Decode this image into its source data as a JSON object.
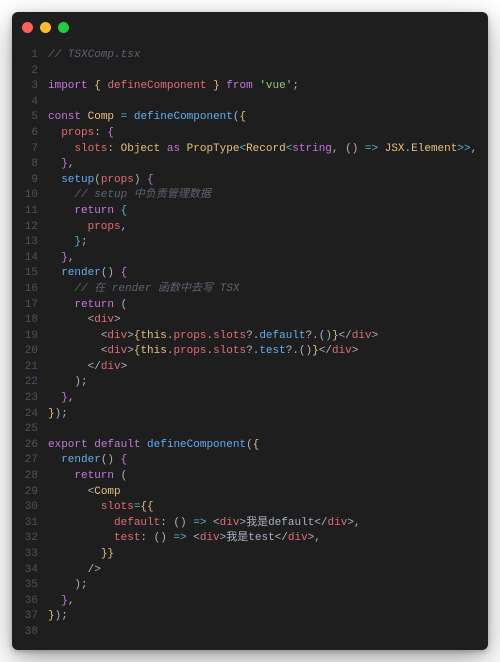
{
  "window": {
    "buttons": [
      "close",
      "minimize",
      "zoom"
    ]
  },
  "code": {
    "lines": [
      {
        "n": "1",
        "tokens": [
          [
            "cm",
            "// TSXComp.tsx"
          ]
        ]
      },
      {
        "n": "2",
        "tokens": [
          [
            "pn",
            ""
          ]
        ]
      },
      {
        "n": "3",
        "tokens": [
          [
            "kw",
            "import"
          ],
          [
            "pn",
            " "
          ],
          [
            "br",
            "{"
          ],
          [
            "pn",
            " "
          ],
          [
            "id",
            "defineComponent"
          ],
          [
            "pn",
            " "
          ],
          [
            "br",
            "}"
          ],
          [
            "pn",
            " "
          ],
          [
            "kw",
            "from"
          ],
          [
            "pn",
            " "
          ],
          [
            "str",
            "'vue'"
          ],
          [
            "pn",
            ";"
          ]
        ]
      },
      {
        "n": "4",
        "tokens": [
          [
            "pn",
            ""
          ]
        ]
      },
      {
        "n": "5",
        "tokens": [
          [
            "kw",
            "const"
          ],
          [
            "pn",
            " "
          ],
          [
            "id2",
            "Comp"
          ],
          [
            "pn",
            " "
          ],
          [
            "op",
            "="
          ],
          [
            "pn",
            " "
          ],
          [
            "fn",
            "defineComponent"
          ],
          [
            "pn",
            "("
          ],
          [
            "br",
            "{"
          ]
        ]
      },
      {
        "n": "6",
        "tokens": [
          [
            "pn",
            "  "
          ],
          [
            "id",
            "props"
          ],
          [
            "pn",
            ": "
          ],
          [
            "br2",
            "{"
          ]
        ]
      },
      {
        "n": "7",
        "tokens": [
          [
            "pn",
            "    "
          ],
          [
            "id",
            "slots"
          ],
          [
            "pn",
            ": "
          ],
          [
            "id2",
            "Object"
          ],
          [
            "pn",
            " "
          ],
          [
            "kw",
            "as"
          ],
          [
            "pn",
            " "
          ],
          [
            "id2",
            "PropType"
          ],
          [
            "op",
            "<"
          ],
          [
            "id2",
            "Record"
          ],
          [
            "op",
            "<"
          ],
          [
            "kw",
            "string"
          ],
          [
            "pn",
            ", "
          ],
          [
            "pn",
            "() "
          ],
          [
            "op",
            "=>"
          ],
          [
            "pn",
            " "
          ],
          [
            "id2",
            "JSX"
          ],
          [
            "pn",
            "."
          ],
          [
            "id2",
            "Element"
          ],
          [
            "op",
            ">>"
          ],
          [
            "pn",
            ","
          ]
        ]
      },
      {
        "n": "8",
        "tokens": [
          [
            "pn",
            "  "
          ],
          [
            "br2",
            "}"
          ],
          [
            "pn",
            ","
          ]
        ]
      },
      {
        "n": "9",
        "tokens": [
          [
            "pn",
            "  "
          ],
          [
            "fn",
            "setup"
          ],
          [
            "pn",
            "("
          ],
          [
            "id",
            "props"
          ],
          [
            "pn",
            ") "
          ],
          [
            "br2",
            "{"
          ]
        ]
      },
      {
        "n": "10",
        "tokens": [
          [
            "pn",
            "    "
          ],
          [
            "cm",
            "// setup 中负责管理数据"
          ]
        ]
      },
      {
        "n": "11",
        "tokens": [
          [
            "pn",
            "    "
          ],
          [
            "kw2",
            "return"
          ],
          [
            "pn",
            " "
          ],
          [
            "br3",
            "{"
          ]
        ]
      },
      {
        "n": "12",
        "tokens": [
          [
            "pn",
            "      "
          ],
          [
            "id",
            "props"
          ],
          [
            "pn",
            ","
          ]
        ]
      },
      {
        "n": "13",
        "tokens": [
          [
            "pn",
            "    "
          ],
          [
            "br3",
            "}"
          ],
          [
            "pn",
            ";"
          ]
        ]
      },
      {
        "n": "14",
        "tokens": [
          [
            "pn",
            "  "
          ],
          [
            "br2",
            "}"
          ],
          [
            "pn",
            ","
          ]
        ]
      },
      {
        "n": "15",
        "tokens": [
          [
            "pn",
            "  "
          ],
          [
            "fn",
            "render"
          ],
          [
            "pn",
            "() "
          ],
          [
            "br2",
            "{"
          ]
        ]
      },
      {
        "n": "16",
        "tokens": [
          [
            "pn",
            "    "
          ],
          [
            "cm",
            "// 在 render 函数中去写 TSX"
          ]
        ]
      },
      {
        "n": "17",
        "tokens": [
          [
            "pn",
            "    "
          ],
          [
            "kw2",
            "return"
          ],
          [
            "pn",
            " ("
          ]
        ]
      },
      {
        "n": "18",
        "tokens": [
          [
            "pn",
            "      "
          ],
          [
            "pn",
            "<"
          ],
          [
            "tag",
            "div"
          ],
          [
            "pn",
            ">"
          ]
        ]
      },
      {
        "n": "19",
        "tokens": [
          [
            "pn",
            "        "
          ],
          [
            "pn",
            "<"
          ],
          [
            "tag",
            "div"
          ],
          [
            "pn",
            ">"
          ],
          [
            "br",
            "{"
          ],
          [
            "this",
            "this"
          ],
          [
            "pn",
            "."
          ],
          [
            "id",
            "props"
          ],
          [
            "pn",
            "."
          ],
          [
            "id",
            "slots"
          ],
          [
            "pn",
            "?."
          ],
          [
            "fn",
            "default"
          ],
          [
            "pn",
            "?.()"
          ],
          [
            "br",
            "}"
          ],
          [
            "pn",
            "</"
          ],
          [
            "tag",
            "div"
          ],
          [
            "pn",
            ">"
          ]
        ]
      },
      {
        "n": "20",
        "tokens": [
          [
            "pn",
            "        "
          ],
          [
            "pn",
            "<"
          ],
          [
            "tag",
            "div"
          ],
          [
            "pn",
            ">"
          ],
          [
            "br",
            "{"
          ],
          [
            "this",
            "this"
          ],
          [
            "pn",
            "."
          ],
          [
            "id",
            "props"
          ],
          [
            "pn",
            "."
          ],
          [
            "id",
            "slots"
          ],
          [
            "pn",
            "?."
          ],
          [
            "fn",
            "test"
          ],
          [
            "pn",
            "?.()"
          ],
          [
            "br",
            "}"
          ],
          [
            "pn",
            "</"
          ],
          [
            "tag",
            "div"
          ],
          [
            "pn",
            ">"
          ]
        ]
      },
      {
        "n": "21",
        "tokens": [
          [
            "pn",
            "      "
          ],
          [
            "pn",
            "</"
          ],
          [
            "tag",
            "div"
          ],
          [
            "pn",
            ">"
          ]
        ]
      },
      {
        "n": "22",
        "tokens": [
          [
            "pn",
            "    "
          ],
          [
            "pn",
            ");"
          ]
        ]
      },
      {
        "n": "23",
        "tokens": [
          [
            "pn",
            "  "
          ],
          [
            "br2",
            "}"
          ],
          [
            "pn",
            ","
          ]
        ]
      },
      {
        "n": "24",
        "tokens": [
          [
            "br",
            "}"
          ],
          [
            "pn",
            ");"
          ]
        ]
      },
      {
        "n": "25",
        "tokens": [
          [
            "pn",
            ""
          ]
        ]
      },
      {
        "n": "26",
        "tokens": [
          [
            "kw",
            "export"
          ],
          [
            "pn",
            " "
          ],
          [
            "kw",
            "default"
          ],
          [
            "pn",
            " "
          ],
          [
            "fn",
            "defineComponent"
          ],
          [
            "pn",
            "("
          ],
          [
            "br",
            "{"
          ]
        ]
      },
      {
        "n": "27",
        "tokens": [
          [
            "pn",
            "  "
          ],
          [
            "fn",
            "render"
          ],
          [
            "pn",
            "() "
          ],
          [
            "br2",
            "{"
          ]
        ]
      },
      {
        "n": "28",
        "tokens": [
          [
            "pn",
            "    "
          ],
          [
            "kw2",
            "return"
          ],
          [
            "pn",
            " ("
          ]
        ]
      },
      {
        "n": "29",
        "tokens": [
          [
            "pn",
            "      "
          ],
          [
            "pn",
            "<"
          ],
          [
            "id2",
            "Comp"
          ]
        ]
      },
      {
        "n": "30",
        "tokens": [
          [
            "pn",
            "        "
          ],
          [
            "id",
            "slots"
          ],
          [
            "op",
            "="
          ],
          [
            "br",
            "{{"
          ]
        ]
      },
      {
        "n": "31",
        "tokens": [
          [
            "pn",
            "          "
          ],
          [
            "id",
            "default"
          ],
          [
            "pn",
            ": () "
          ],
          [
            "op",
            "=>"
          ],
          [
            "pn",
            " <"
          ],
          [
            "tag",
            "div"
          ],
          [
            "pn",
            ">"
          ],
          [
            "pn",
            "我是default"
          ],
          [
            "pn",
            "</"
          ],
          [
            "tag",
            "div"
          ],
          [
            "pn",
            ">,"
          ]
        ]
      },
      {
        "n": "32",
        "tokens": [
          [
            "pn",
            "          "
          ],
          [
            "id",
            "test"
          ],
          [
            "pn",
            ": () "
          ],
          [
            "op",
            "=>"
          ],
          [
            "pn",
            " <"
          ],
          [
            "tag",
            "div"
          ],
          [
            "pn",
            ">"
          ],
          [
            "pn",
            "我是test"
          ],
          [
            "pn",
            "</"
          ],
          [
            "tag",
            "div"
          ],
          [
            "pn",
            ">,"
          ]
        ]
      },
      {
        "n": "33",
        "tokens": [
          [
            "pn",
            "        "
          ],
          [
            "br",
            "}}"
          ]
        ]
      },
      {
        "n": "34",
        "tokens": [
          [
            "pn",
            "      "
          ],
          [
            "pn",
            "/>"
          ]
        ]
      },
      {
        "n": "35",
        "tokens": [
          [
            "pn",
            "    "
          ],
          [
            "pn",
            ");"
          ]
        ]
      },
      {
        "n": "36",
        "tokens": [
          [
            "pn",
            "  "
          ],
          [
            "br2",
            "}"
          ],
          [
            "pn",
            ","
          ]
        ]
      },
      {
        "n": "37",
        "tokens": [
          [
            "br",
            "}"
          ],
          [
            "pn",
            ");"
          ]
        ]
      },
      {
        "n": "38",
        "tokens": [
          [
            "pn",
            ""
          ]
        ]
      }
    ]
  }
}
